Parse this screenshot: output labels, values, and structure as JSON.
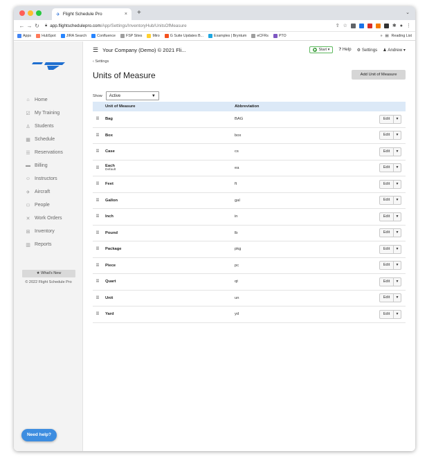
{
  "browser": {
    "tab_title": "Flight Schedule Pro",
    "url_host": "app.flightschedulepro.com",
    "url_path": "/App/Settings/InventoryHub/UnitsOfMeasure",
    "bookmarks": [
      {
        "label": "Apps",
        "color": "#4285f4"
      },
      {
        "label": "HubSpot",
        "color": "#ff7a59"
      },
      {
        "label": "JIRA Search",
        "color": "#2684ff"
      },
      {
        "label": "Confluence",
        "color": "#2684ff"
      },
      {
        "label": "FSP Sites",
        "color": "#9e9e9e"
      },
      {
        "label": "Miro",
        "color": "#ffd02f"
      },
      {
        "label": "G Suite Updates B...",
        "color": "#f4511e"
      },
      {
        "label": "Examples | Bryntum",
        "color": "#1ea7e1"
      },
      {
        "label": "eCFRs",
        "color": "#9e9e9e"
      },
      {
        "label": "PTO",
        "color": "#7e57c2"
      }
    ],
    "reading_list": "Reading List"
  },
  "topbar": {
    "company": "Your Company (Demo) © 2021 Fli...",
    "start_label": "Start",
    "help_label": "Help",
    "settings_label": "Settings",
    "user_label": "Andrew"
  },
  "sidebar": {
    "items": [
      {
        "label": "Home",
        "icon": "home-icon",
        "glyph": "⌂"
      },
      {
        "label": "My Training",
        "icon": "training-icon",
        "glyph": "☑"
      },
      {
        "label": "Students",
        "icon": "students-icon",
        "glyph": "♙"
      },
      {
        "label": "Schedule",
        "icon": "calendar-icon",
        "glyph": "▦"
      },
      {
        "label": "Reservations",
        "icon": "list-icon",
        "glyph": "☰"
      },
      {
        "label": "Billing",
        "icon": "billing-icon",
        "glyph": "▬"
      },
      {
        "label": "Instructors",
        "icon": "instructor-icon",
        "glyph": "☺"
      },
      {
        "label": "Aircraft",
        "icon": "plane-icon",
        "glyph": "✈"
      },
      {
        "label": "People",
        "icon": "people-icon",
        "glyph": "⚇"
      },
      {
        "label": "Work Orders",
        "icon": "wrench-icon",
        "glyph": "✕"
      },
      {
        "label": "Inventory",
        "icon": "inventory-icon",
        "glyph": "⊞"
      },
      {
        "label": "Reports",
        "icon": "chart-icon",
        "glyph": "▥"
      }
    ],
    "whats_new": "What's New",
    "copyright": "© 2022 Flight Schedule Pro",
    "need_help": "Need help?"
  },
  "page": {
    "back_label": "Settings",
    "title": "Units of Measure",
    "add_button": "Add Unit of Measure",
    "show_label": "Show",
    "show_value": "Active"
  },
  "table": {
    "headers": {
      "name": "Unit of Measure",
      "abbr": "Abbreviation"
    },
    "edit_label": "Edit",
    "rows": [
      {
        "name": "Bag",
        "abbr": "BAG",
        "sub": ""
      },
      {
        "name": "Box",
        "abbr": "box",
        "sub": ""
      },
      {
        "name": "Case",
        "abbr": "cs",
        "sub": ""
      },
      {
        "name": "Each",
        "abbr": "ea",
        "sub": "Default"
      },
      {
        "name": "Feet",
        "abbr": "ft",
        "sub": ""
      },
      {
        "name": "Gallon",
        "abbr": "gal",
        "sub": ""
      },
      {
        "name": "Inch",
        "abbr": "in",
        "sub": ""
      },
      {
        "name": "Pound",
        "abbr": "lb",
        "sub": ""
      },
      {
        "name": "Package",
        "abbr": "pkg",
        "sub": ""
      },
      {
        "name": "Piece",
        "abbr": "pc",
        "sub": ""
      },
      {
        "name": "Quart",
        "abbr": "qt",
        "sub": ""
      },
      {
        "name": "Unit",
        "abbr": "un",
        "sub": ""
      },
      {
        "name": "Yard",
        "abbr": "yd",
        "sub": ""
      }
    ]
  },
  "colors": {
    "accent": "#3d8de0",
    "header_row": "#dce9f7",
    "logo": "#1f6fd0"
  }
}
